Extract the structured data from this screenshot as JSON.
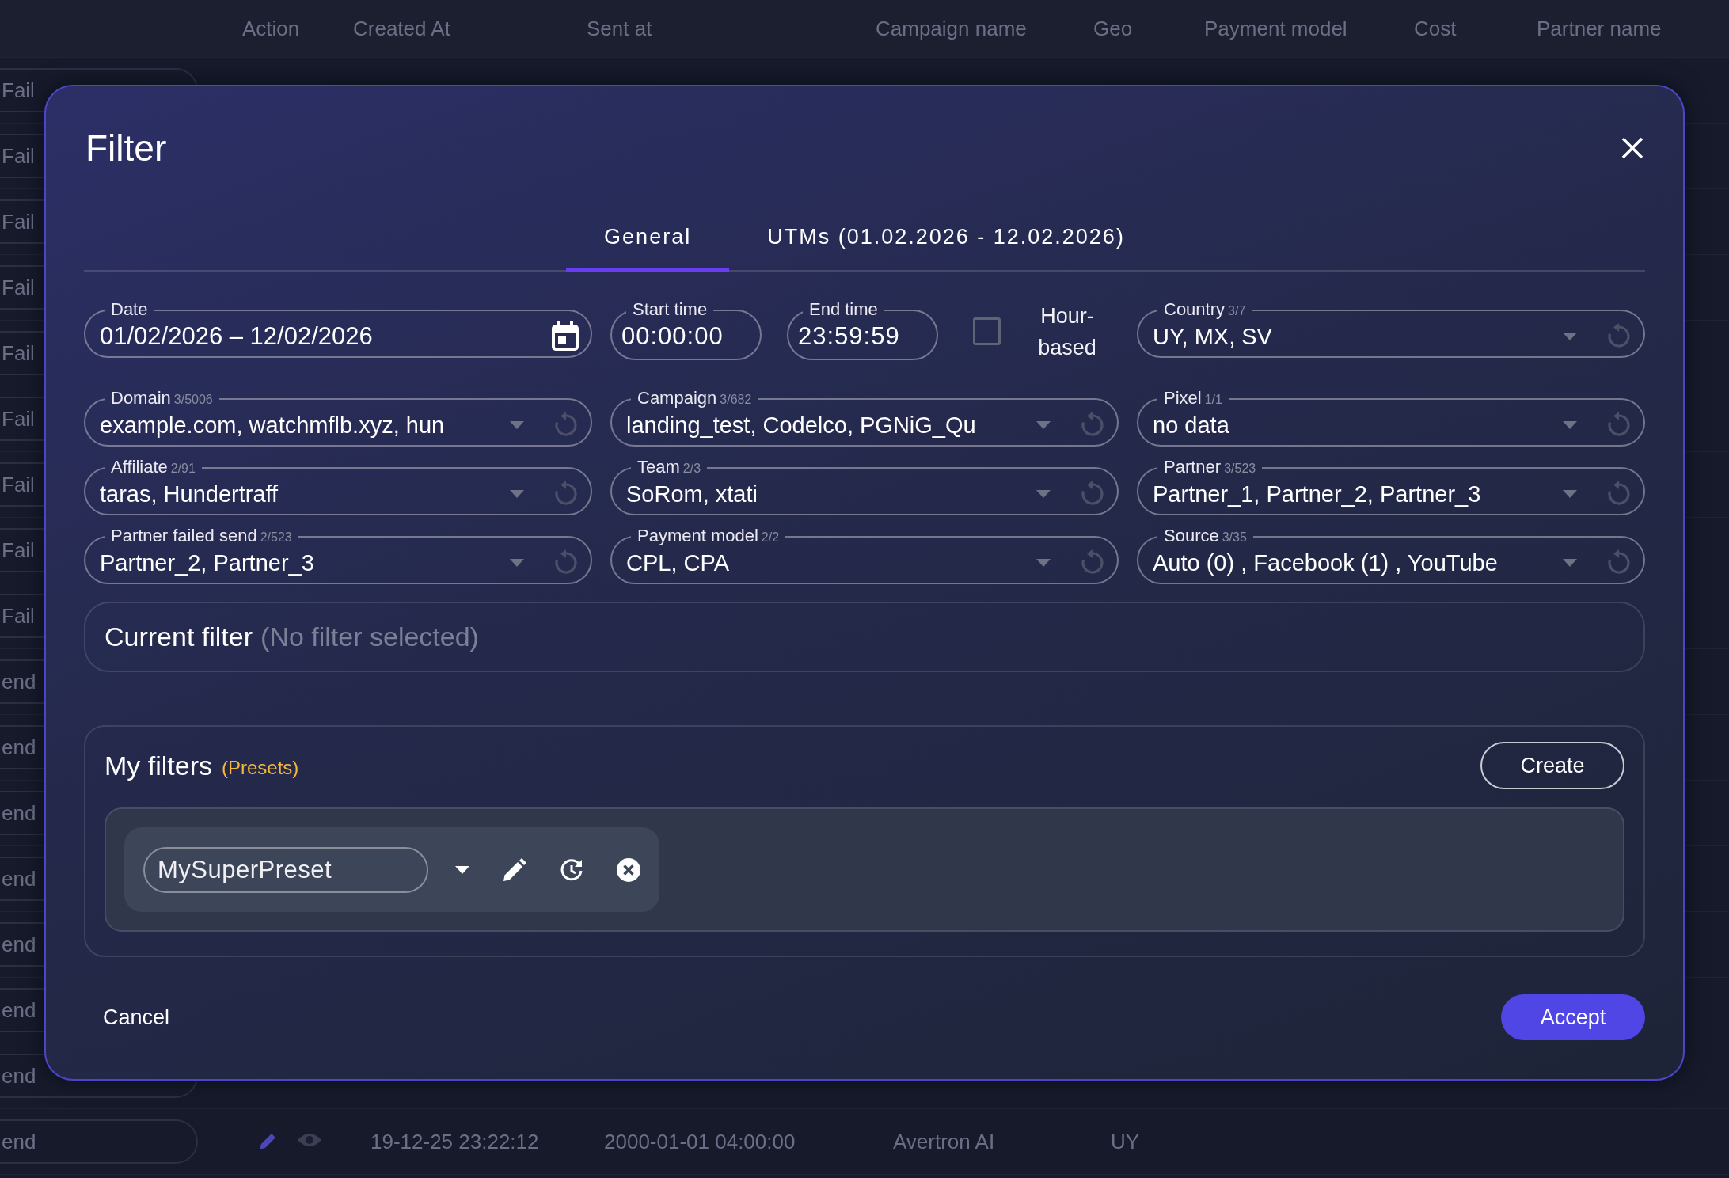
{
  "background_table": {
    "columns": [
      "Action",
      "Created At",
      "Sent at",
      "Campaign name",
      "Geo",
      "Payment model",
      "Cost",
      "Partner name"
    ],
    "status_cells": [
      "Fail",
      "Fail",
      "Fail",
      "Fail",
      "Fail",
      "Fail",
      "Fail",
      "Fail",
      "Fail",
      "end",
      "end",
      "end",
      "end",
      "end",
      "end",
      "end"
    ],
    "last_row": {
      "status": "end",
      "created_at": "19-12-25 23:22:12",
      "sent_at": "2000-01-01 04:00:00",
      "campaign_name": "Avertron AI",
      "geo": "UY"
    }
  },
  "dialog": {
    "title": "Filter",
    "tabs": [
      {
        "label": "General",
        "selected": true
      },
      {
        "label": "UTMs (01.02.2026 - 12.02.2026)",
        "selected": false
      }
    ],
    "fields": [
      {
        "kind": "date",
        "label": "Date",
        "value": "01/02/2026 – 12/02/2026"
      },
      {
        "kind": "time",
        "times": [
          {
            "label": "Start time",
            "value": "00:00:00"
          },
          {
            "label": "End time",
            "value": "23:59:59"
          }
        ],
        "checkbox": {
          "label": "Hour-based",
          "checked": false
        }
      },
      {
        "kind": "select",
        "label": "Country",
        "count": "3/7",
        "value": "UY, MX, SV"
      },
      {
        "kind": "select",
        "label": "Domain",
        "count": "3/5006",
        "value": "example.com, watchmflb.xyz, hun"
      },
      {
        "kind": "select",
        "label": "Campaign",
        "count": "3/682",
        "value": "landing_test, Codelco, PGNiG_Qu"
      },
      {
        "kind": "select",
        "label": "Pixel",
        "count": "1/1",
        "value": "no data"
      },
      {
        "kind": "select",
        "label": "Affiliate",
        "count": "2/91",
        "value": "taras, Hundertraff"
      },
      {
        "kind": "select",
        "label": "Team",
        "count": "2/3",
        "value": "SoRom, xtati"
      },
      {
        "kind": "select",
        "label": "Partner",
        "count": "3/523",
        "value": "Partner_1, Partner_2, Partner_3"
      },
      {
        "kind": "select",
        "label": "Partner failed send",
        "count": "2/523",
        "value": "Partner_2, Partner_3"
      },
      {
        "kind": "select",
        "label": "Payment model",
        "count": "2/2",
        "value": "CPL, CPA"
      },
      {
        "kind": "select",
        "label": "Source",
        "count": "3/35",
        "value": "Auto (0) , Facebook (1) , YouTube"
      }
    ],
    "current_filter": {
      "label": "Current filter",
      "value": "(No filter selected)"
    },
    "my_filters": {
      "title": "My filters",
      "subtitle": "(Presets)",
      "create_button": "Create",
      "presets": [
        {
          "name": "MySuperPreset"
        }
      ]
    },
    "cancel_button": "Cancel",
    "accept_button": "Accept"
  }
}
